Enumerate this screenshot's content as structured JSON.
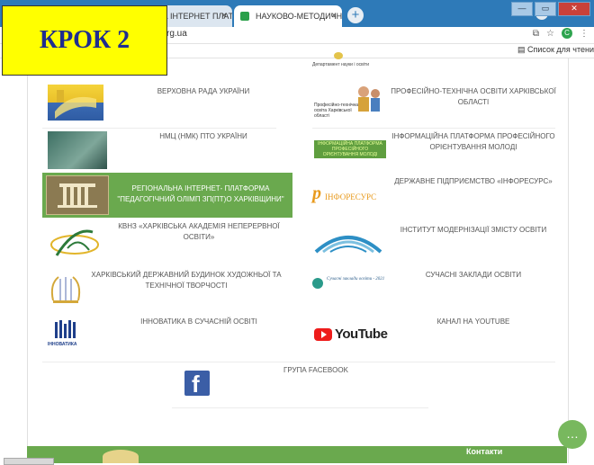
{
  "step_label": "КРОК 2",
  "browser": {
    "tabs": [
      {
        "label": "НА ІНТЕРНЕТ ПЛАТФ",
        "close": "×"
      },
      {
        "label": "НАУКОВО-МЕТОДИЧНИЙ ЦЕН",
        "close": "×"
      }
    ],
    "new_tab": "+",
    "window_buttons": {
      "minimize": "—",
      "maximize": "▭",
      "close": "✕"
    },
    "url": "rg.ua",
    "tools": {
      "star": "☆",
      "avatar": "C",
      "menu": "⋮"
    },
    "reading_list": "Список для чтени"
  },
  "header_partial": {
    "title": "Департамент науки і освіти"
  },
  "links": [
    {
      "title": "ВЕРХОВНА РАДА УКРАЇНИ"
    },
    {
      "title": "ПРОФЕСІЙНО-ТЕХНІЧНА ОСВІТИ ХАРКІВСЬКОЇ ОБЛАСТІ",
      "logo_text": "Професійно-технічна освіта Харківської області"
    },
    {
      "title": "НМЦ (НМК) ПТО УКРАЇНИ"
    },
    {
      "title": "ІНФОРМАЦІЙНА ПЛАТФОРМА ПРОФЕСІЙНОГО ОРІЄНТУВАННЯ МОЛОДІ",
      "logo_text": "ІНФОРМАЦІЙНА ПЛАТФОРМА ПРОФЕСІЙНОГО ОРІЄНТУВАННЯ МОЛОДІ"
    },
    {
      "title": "РЕГІОНАЛЬНА ІНТЕРНЕТ- ПЛАТФОРМА \"ПЕДАГОГІЧНИЙ ОЛІМП ЗП(ПТ)О ХАРКІВЩИНИ\""
    },
    {
      "title": "ДЕРЖАВНЕ ПІДПРИЄМСТВО «ІНФОРЕСУРС»",
      "logo_text": "ІНФОРЕСУРС"
    },
    {
      "title": "КВНЗ «ХАРКІВСЬКА АКАДЕМІЯ НЕПЕРЕРВНОЇ ОСВІТИ»"
    },
    {
      "title": "ІНСТИТУТ МОДЕРНІЗАЦІЇ ЗМІСТУ ОСВІТИ"
    },
    {
      "title": "ХАРКІВСЬКИЙ ДЕРЖАВНИЙ БУДИНОК ХУДОЖНЬОЇ ТА ТЕХНІЧНОЇ ТВОРЧОСТІ"
    },
    {
      "title": "СУЧАСНІ ЗАКЛАДИ ОСВІТИ",
      "logo_text": "Сучасні заклади освіти - 2021"
    },
    {
      "title": "ІННОВАТИКА В СУЧАСНІЙ ОСВІТІ",
      "logo_text": "ІННОВАТИКА"
    },
    {
      "title": "КАНАЛ НА YOUTUBE",
      "logo_text": "YouTube"
    },
    {
      "title": "ГРУПА FACEBOOK",
      "logo_text": "f"
    }
  ],
  "footer": {
    "contacts": "Контакти"
  },
  "colors": {
    "green": "#6aa94e",
    "step_bg": "#ffff00",
    "step_text": "#1f2d8f",
    "chrome": "#2e7ab8"
  },
  "icons": [
    "chat-icon",
    "star-icon",
    "facebook-icon",
    "youtube-icon"
  ]
}
